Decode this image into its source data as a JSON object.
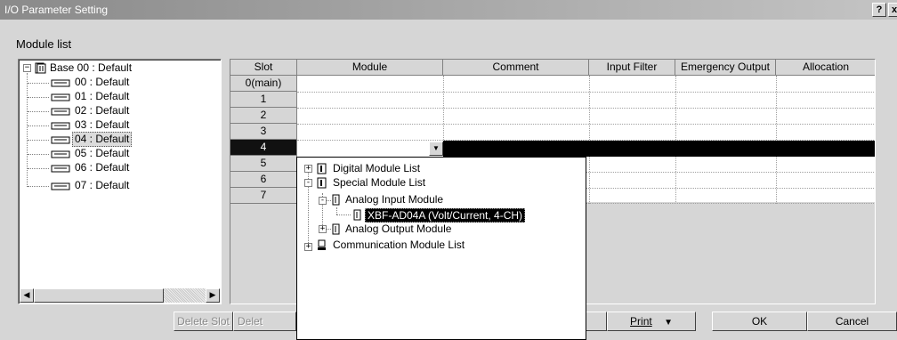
{
  "window": {
    "title": "I/O Parameter Setting",
    "help_label": "?",
    "close_label": "x"
  },
  "module_list_label": "Module list",
  "tree": {
    "root": "Base 00 : Default",
    "items": [
      "00 : Default",
      "01 : Default",
      "02 : Default",
      "03 : Default",
      "04 : Default",
      "05 : Default",
      "06 : Default",
      "07 : Default"
    ],
    "selected_index": 4
  },
  "grid": {
    "columns": [
      "Slot",
      "Module",
      "Comment",
      "Input Filter",
      "Emergency Output",
      "Allocation"
    ],
    "slots": [
      "0(main)",
      "1",
      "2",
      "3",
      "4",
      "5",
      "6",
      "7"
    ],
    "active_slot_index": 4
  },
  "module_dropdown": {
    "items": [
      {
        "label": "Digital Module List",
        "level": 0,
        "expander": "+"
      },
      {
        "label": "Special Module List",
        "level": 0,
        "expander": "-"
      },
      {
        "label": "Analog Input Module",
        "level": 1,
        "expander": "-"
      },
      {
        "label": "XBF-AD04A (Volt/Current, 4-CH)",
        "level": 2,
        "expander": ""
      },
      {
        "label": "Analog Output Module",
        "level": 1,
        "expander": "+"
      },
      {
        "label": "Communication Module List",
        "level": 0,
        "expander": "+"
      }
    ],
    "selected_label": "XBF-AD04A (Volt/Current, 4-CH)"
  },
  "buttons": {
    "delete_slot": "Delete Slot",
    "delete_all_partial": "Delet",
    "print": "Print",
    "print_arrow": "▼",
    "ok": "OK",
    "cancel": "Cancel"
  },
  "scrollbar": {
    "left_arrow": "◀",
    "right_arrow": "▶"
  },
  "combo_arrow": "▼"
}
